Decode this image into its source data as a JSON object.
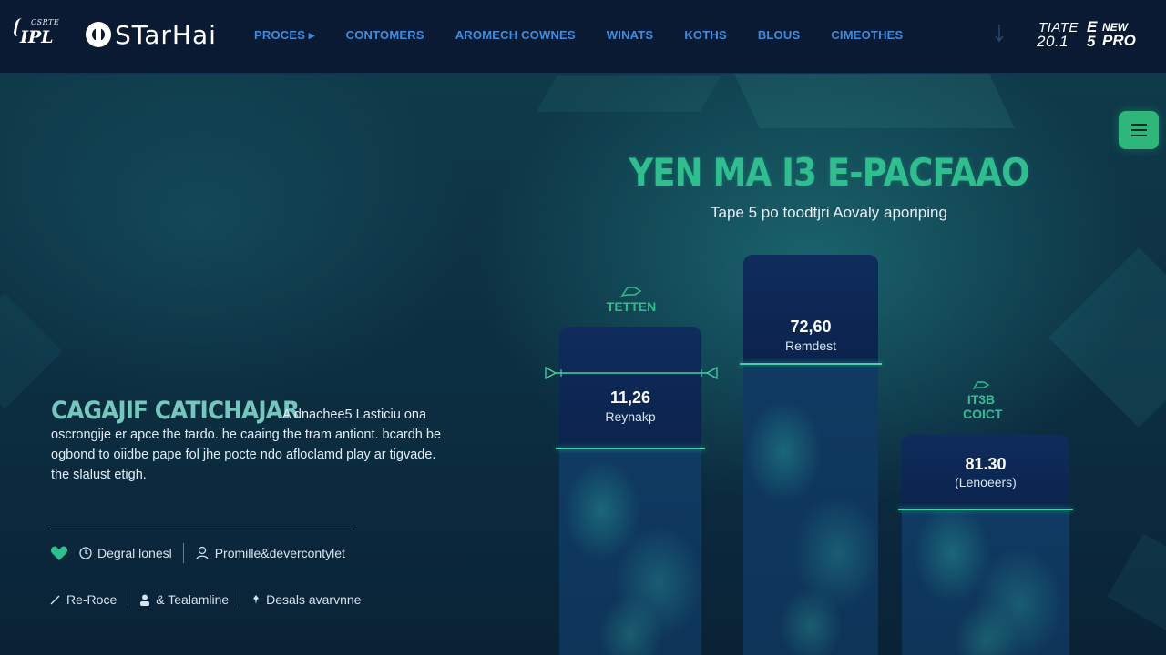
{
  "nav": {
    "ipl_small": "CSRTE",
    "ipl_big": "IPL",
    "brand": "STarHai",
    "menu": [
      "PROCES ▸",
      "CONTOMERS",
      "AROMECH COWNES",
      "WINATS",
      "KOTHS",
      "BLOUS",
      "CIMEOTHES"
    ],
    "promo": {
      "l1": "TIATE",
      "l2": "20.1",
      "r1": "E",
      "r2": "5",
      "new": "NEW",
      "pro": "PRO"
    }
  },
  "hero": {
    "title": "YEN MA I3 E-PACFAAO",
    "subtitle": "Tape 5 po toodtjri Aovaly aporiping"
  },
  "bars": [
    {
      "tag": "TETTEN",
      "value": "11,26",
      "label": "Reynakp"
    },
    {
      "tag": "",
      "value": "72,60",
      "label": "Remdest"
    },
    {
      "tag": "IT3B COICT",
      "value": "81.30",
      "label": "(Lenoeers)"
    }
  ],
  "left": {
    "title": "CAGAJIF CATICHAJAR",
    "body_lead": "A dnachee5 Lasticiu ona",
    "body_rest": "oscrongije er apce the tardo. he caaing the tram antiont. bcardh be ogbond to oiidbe pape fol jhe pocte ndo afloclamd play ar tigvade. the slalust etigh.",
    "meta1": [
      "Degral lonesl",
      "Promille&devercontylet"
    ],
    "meta2": [
      "Re-Roce",
      "& Tealamline",
      "Desals avarvnne"
    ]
  },
  "colors": {
    "accent": "#2fbf8f",
    "nav_link": "#3d8ee0",
    "nav_bg": "#0a1a33",
    "bar_fill": "#0f2c5c"
  }
}
